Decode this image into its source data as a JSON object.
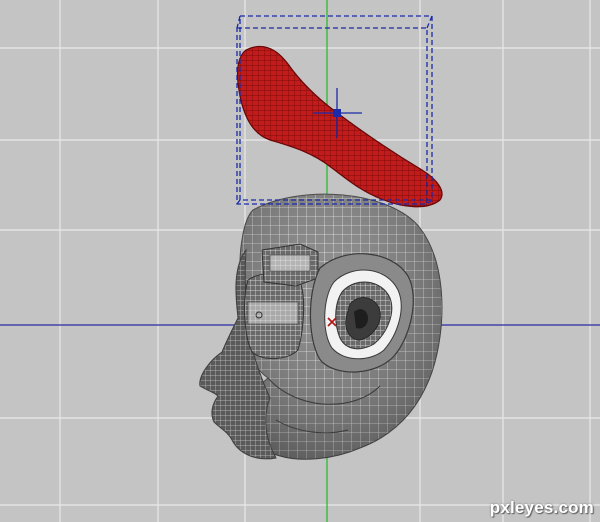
{
  "viewport": {
    "view": "left",
    "background_color": "#c4c4c4",
    "grid_color": "#e8e8e8",
    "grid": true
  },
  "axes": {
    "vertical_axis_color": "#2dbb2d",
    "horizontal_axis_color": "#2a2aa0"
  },
  "scene": {
    "objects": [
      {
        "name": "selected-mesh",
        "color": "#d21e1e",
        "selected": true
      },
      {
        "name": "head-mesh",
        "color": "#7c7c7c",
        "selected": false
      }
    ],
    "selection_box_color": "#1a2aa8",
    "pivot_color": "#1a2aa8",
    "origin_marker_color": "#b01414"
  },
  "watermark": {
    "text": "pxleyes.com"
  }
}
